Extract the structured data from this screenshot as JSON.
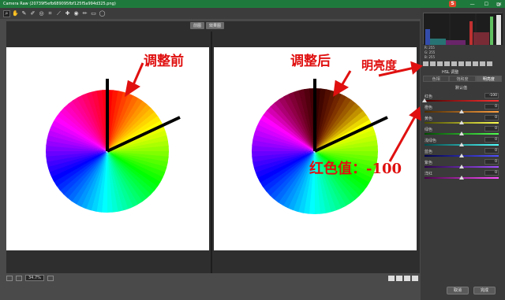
{
  "window": {
    "title": "Camera Raw (20739f5efb689095fbf125f5a994d325.png)"
  },
  "toolbar": {
    "tools": [
      "zoom-icon",
      "hand-icon",
      "white-balance-icon",
      "color-sampler-icon",
      "target-adjust-icon",
      "crop-icon",
      "straighten-icon",
      "spot-removal-icon",
      "red-eye-icon",
      "adjustment-brush-icon",
      "graduated-filter-icon",
      "radial-filter-icon"
    ]
  },
  "view": {
    "before_label": "前图",
    "after_label": "效果图",
    "zoom": "34.7%"
  },
  "histogram": {
    "r": "R:  255",
    "g": "G:  255",
    "b": "B:  255"
  },
  "hsl": {
    "panel_title": "HSL 调整",
    "tabs": [
      "色相",
      "饱和度",
      "明亮度"
    ],
    "active_tab": 2,
    "default_label": "默认值",
    "sliders": [
      {
        "label": "红色",
        "value": "-100",
        "pos": 0.0,
        "grad": [
          "#4a0000",
          "#ff3030"
        ]
      },
      {
        "label": "橙色",
        "value": "0",
        "pos": 0.5,
        "grad": [
          "#4a2a00",
          "#ffa040"
        ]
      },
      {
        "label": "黄色",
        "value": "0",
        "pos": 0.5,
        "grad": [
          "#4a4a00",
          "#ffff50"
        ]
      },
      {
        "label": "绿色",
        "value": "0",
        "pos": 0.5,
        "grad": [
          "#004a00",
          "#50ff50"
        ]
      },
      {
        "label": "浅绿色",
        "value": "0",
        "pos": 0.5,
        "grad": [
          "#004a4a",
          "#50ffff"
        ]
      },
      {
        "label": "蓝色",
        "value": "0",
        "pos": 0.5,
        "grad": [
          "#00004a",
          "#5050ff"
        ]
      },
      {
        "label": "紫色",
        "value": "0",
        "pos": 0.5,
        "grad": [
          "#2a004a",
          "#a050ff"
        ]
      },
      {
        "label": "洋红",
        "value": "0",
        "pos": 0.5,
        "grad": [
          "#4a004a",
          "#ff50ff"
        ]
      }
    ]
  },
  "buttons": {
    "cancel": "取消",
    "done": "完成"
  },
  "annotations": {
    "before": "调整前",
    "after": "调整后",
    "luminance": "明亮度",
    "red_value": "红色值：-100"
  },
  "colors": {
    "titlebar": "#1e7a3c",
    "annotation": "#e01010"
  }
}
